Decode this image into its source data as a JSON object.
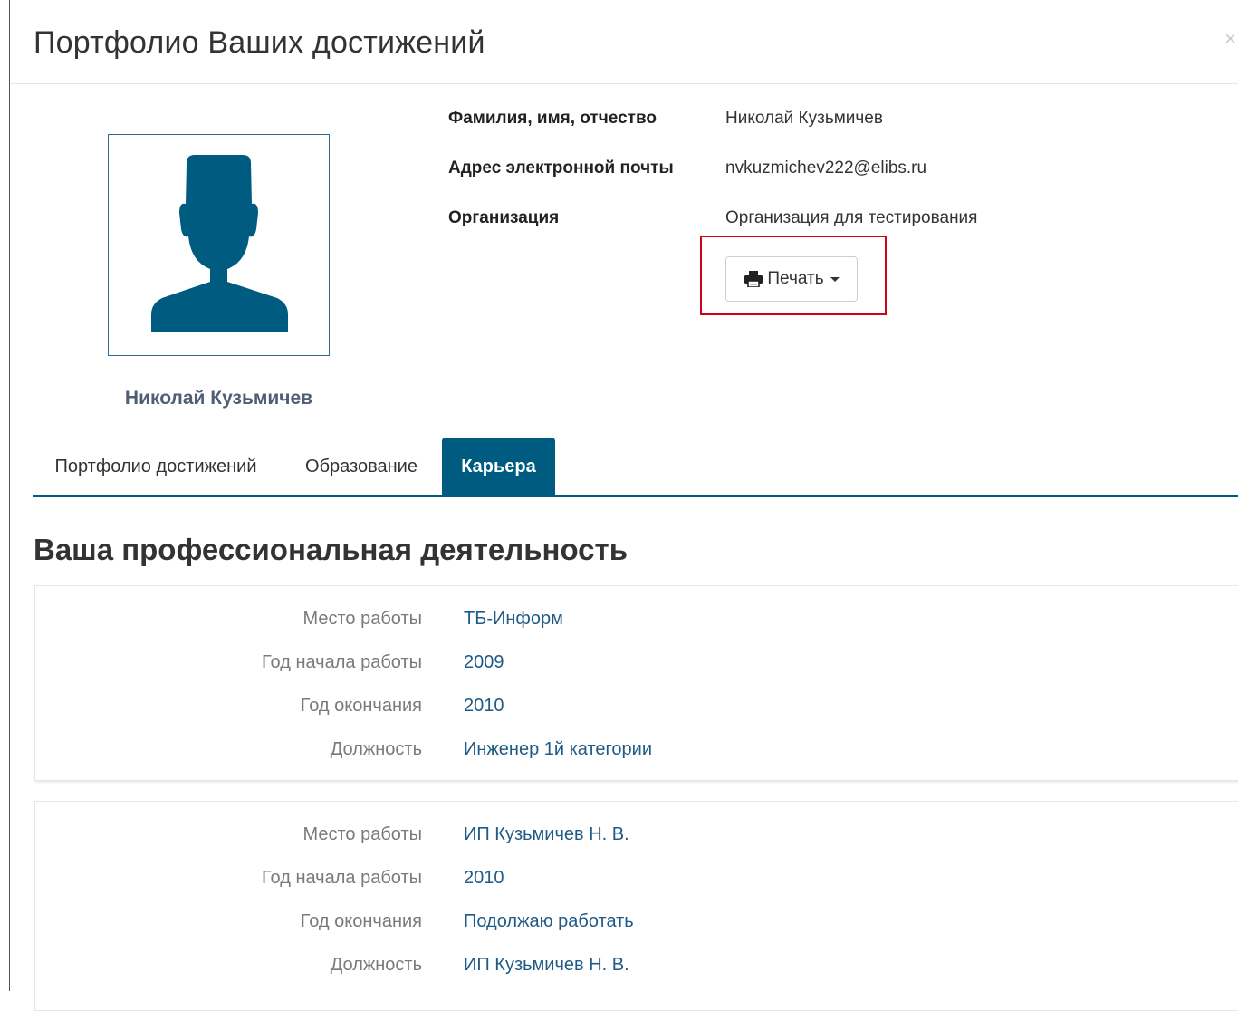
{
  "modal": {
    "title": "Портфолио Ваших достижений",
    "close_label": "×"
  },
  "profile": {
    "name": "Николай Кузьмичев",
    "avatar_icon": "user-silhouette-icon",
    "fields": [
      {
        "label": "Фамилия, имя, отчество",
        "value": "Николай Кузьмичев"
      },
      {
        "label": "Адрес электронной почты",
        "value": "nvkuzmichev222@elibs.ru"
      },
      {
        "label": "Организация",
        "value": "Организация для тестирования"
      }
    ]
  },
  "print": {
    "label": "Печать",
    "icon": "printer-icon"
  },
  "tabs": [
    {
      "label": "Портфолио достижений",
      "active": false
    },
    {
      "label": "Образование",
      "active": false
    },
    {
      "label": "Карьера",
      "active": true
    }
  ],
  "section": {
    "title": "Ваша профессиональная деятельность"
  },
  "careers": [
    {
      "fields": [
        {
          "label": "Место работы",
          "value": "ТБ-Информ"
        },
        {
          "label": "Год начала работы",
          "value": "2009"
        },
        {
          "label": "Год окончания",
          "value": "2010"
        },
        {
          "label": "Должность",
          "value": "Инженер 1й категории"
        }
      ]
    },
    {
      "fields": [
        {
          "label": "Место работы",
          "value": "ИП Кузьмичев Н. В."
        },
        {
          "label": "Год начала работы",
          "value": "2010"
        },
        {
          "label": "Год окончания",
          "value": "Подолжаю работать"
        },
        {
          "label": "Должность",
          "value": "ИП Кузьмичев Н. В."
        }
      ]
    }
  ],
  "colors": {
    "brand": "#005b81",
    "avatar": "#005b81",
    "link_text": "#1f5b86",
    "highlight": "#d0021b"
  }
}
